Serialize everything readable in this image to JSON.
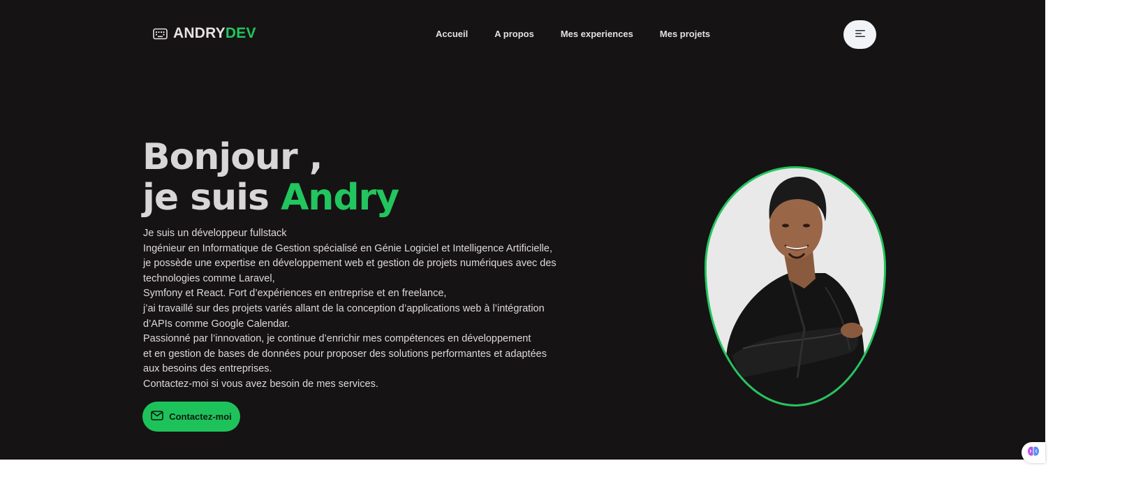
{
  "brand": {
    "part1": "ANDRY",
    "part2": "DEV",
    "icon": "keyboard-icon"
  },
  "nav": [
    {
      "label": "Accueil"
    },
    {
      "label": "A propos"
    },
    {
      "label": "Mes experiences"
    },
    {
      "label": "Mes projets"
    }
  ],
  "menu_icon": "menu-lines-icon",
  "hero": {
    "greeting": "Bonjour ,",
    "intro_prefix": "je suis",
    "name": "Andry",
    "paragraph_lines": [
      "Je suis un développeur fullstack",
      "Ingénieur en Informatique de Gestion spécialisé en Génie Logiciel et Intelligence Artificielle,",
      "je possède une expertise en développement web et gestion de projets numériques avec des",
      "technologies comme Laravel,",
      "Symfony et React. Fort d’expériences en entreprise et en freelance,",
      "j’ai travaillé sur des projets variés allant de la conception d’applications web à l’intégration",
      "d’APIs comme Google Calendar.",
      "Passionné par l’innovation, je continue d’enrichir mes compétences en développement",
      "et en gestion de bases de données pour proposer des solutions performantes et adaptées",
      "aux besoins des entreprises.",
      "Contactez-moi si vous avez besoin de mes services."
    ],
    "cta_label": "Contactez-moi",
    "cta_icon": "mail-icon"
  },
  "colors": {
    "background": "#161314",
    "accent": "#22c55e",
    "text": "#dedadb"
  }
}
